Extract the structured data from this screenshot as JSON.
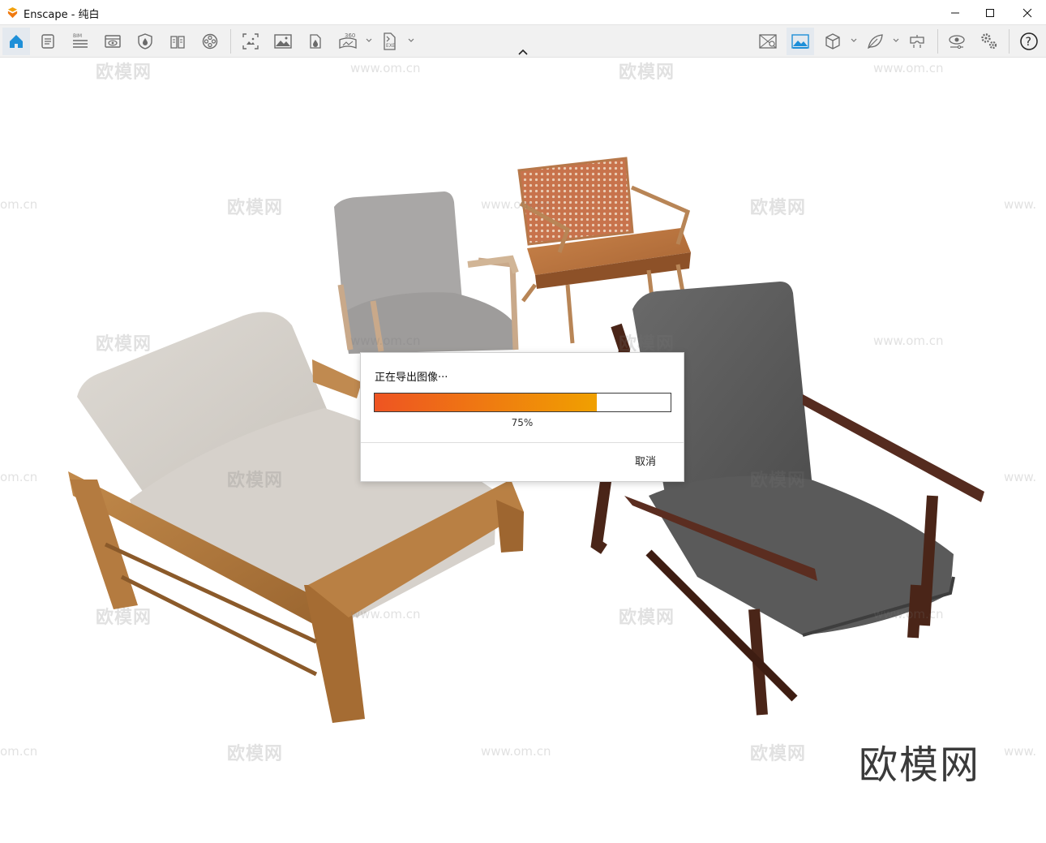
{
  "window": {
    "title": "Enscape - 纯白",
    "controls": {
      "minimize": "minimize-icon",
      "maximize": "maximize-icon",
      "close": "close-icon"
    }
  },
  "toolbar": {
    "left_icons": [
      "home-icon",
      "document-icon",
      "bim-icon",
      "view-eye-icon",
      "shield-drop-icon",
      "book-icon",
      "film-reel-icon",
      "screenshot-icon",
      "landscape-icon",
      "export-drop-icon",
      "panorama-360-icon",
      "export-exe-icon"
    ],
    "right_icons": [
      "map-icon",
      "image-landscape-icon",
      "cube-icon",
      "leaf-icon",
      "vr-headset-icon",
      "eye-settings-icon",
      "gears-icon",
      "help-icon"
    ],
    "bim_label": "BIM",
    "pano_label": "360",
    "exe_label": "EXE",
    "help_label": "?",
    "accent": "#1e8fd8"
  },
  "dialog": {
    "title": "正在导出图像···",
    "progress": 0.75,
    "progress_text": "75%",
    "cancel_label": "取消",
    "bar_colors": [
      "#ee5422",
      "#f0a000"
    ]
  },
  "watermarks": {
    "brand_small": "欧模网",
    "url": "www.om.cn",
    "url_short": "om.cn",
    "url_head": "www.",
    "brand_big": "欧模网"
  }
}
